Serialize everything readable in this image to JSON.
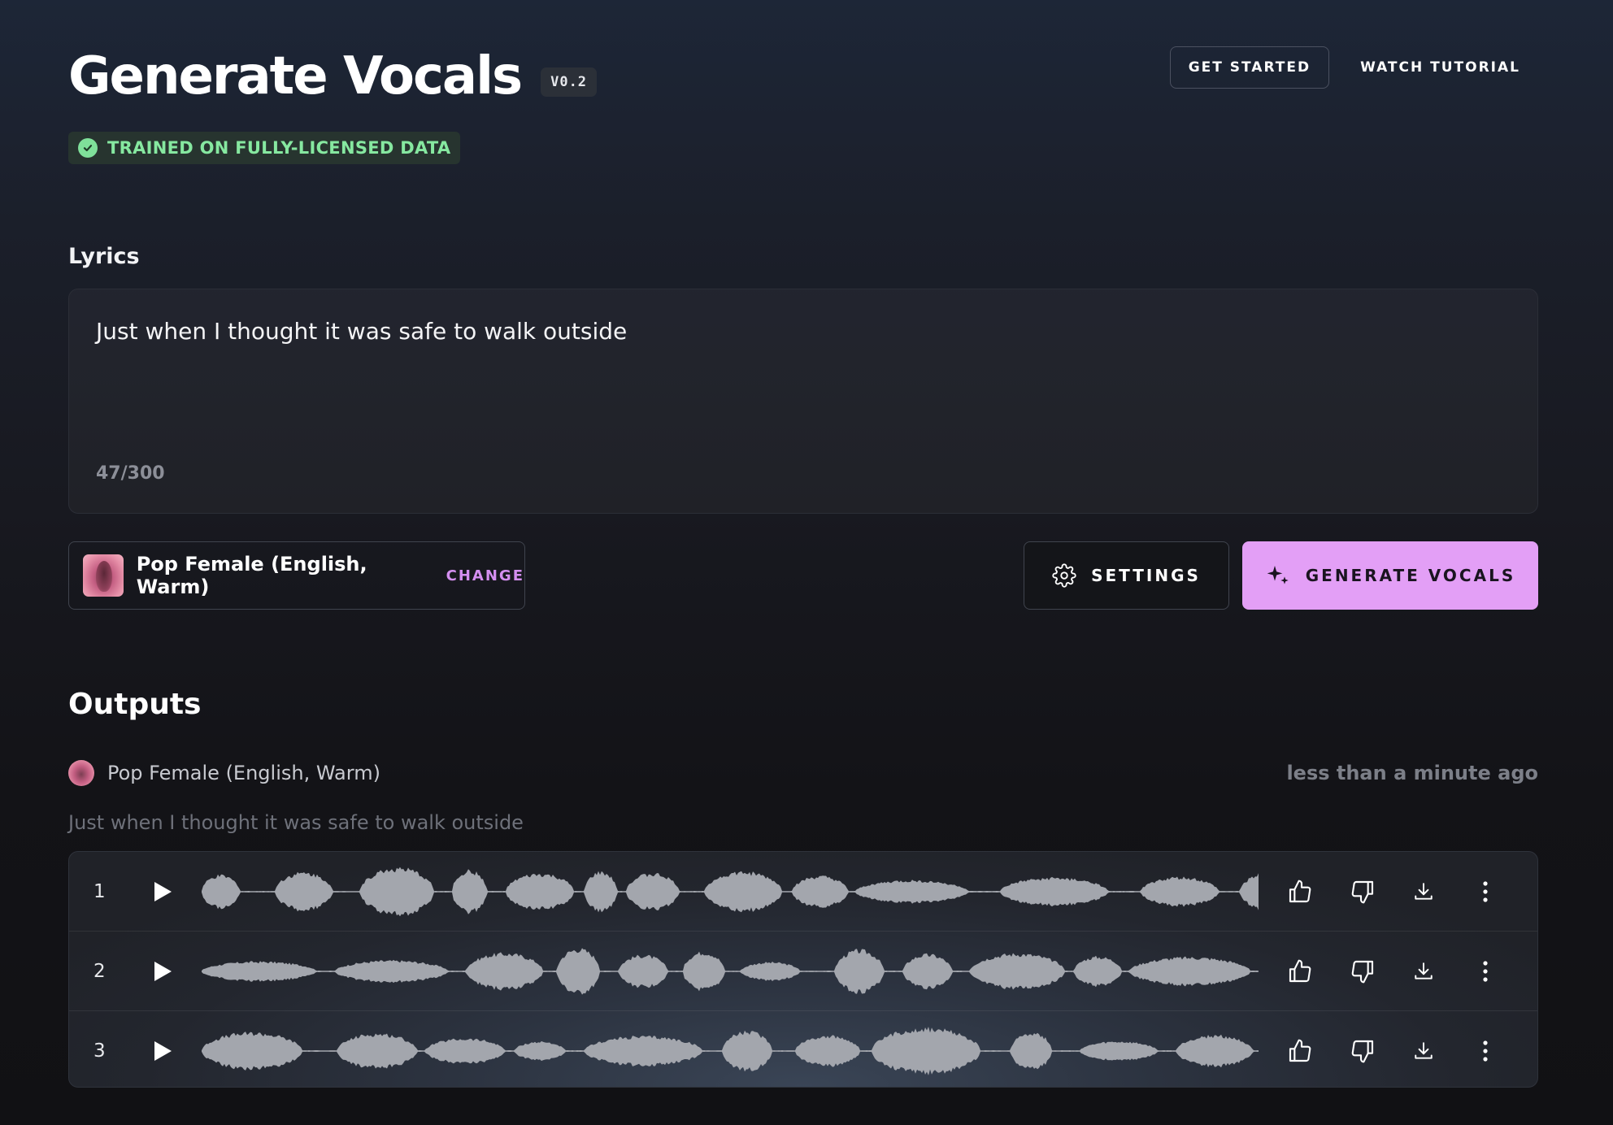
{
  "header": {
    "title": "Generate Vocals",
    "version": "V0.2",
    "get_started": "GET STARTED",
    "watch_tutorial": "WATCH TUTORIAL",
    "badge": "TRAINED ON FULLY-LICENSED DATA"
  },
  "lyrics": {
    "label": "Lyrics",
    "text": "Just when I thought it was safe to walk outside",
    "count": "47/300"
  },
  "controls": {
    "voice_name": "Pop Female (English, Warm)",
    "change": "CHANGE",
    "settings": "SETTINGS",
    "generate": "GENERATE VOCALS"
  },
  "outputs": {
    "title": "Outputs",
    "voice": "Pop Female (English, Warm)",
    "time": "less than a minute ago",
    "lyrics": "Just when I thought it was safe to walk outside",
    "tracks": [
      {
        "num": "1"
      },
      {
        "num": "2"
      },
      {
        "num": "3"
      }
    ]
  },
  "colors": {
    "accent": "#e39ff6",
    "change_link": "#d48ff0",
    "badge_text": "#86e8a0",
    "waveform": "#a3a6ad"
  },
  "icons": {
    "badge": "check-circle-icon",
    "settings": "gear-icon",
    "generate": "sparkles-icon",
    "play": "play-icon",
    "like": "thumbs-up-icon",
    "dislike": "thumbs-down-icon",
    "download": "download-icon",
    "more": "more-vertical-icon"
  }
}
